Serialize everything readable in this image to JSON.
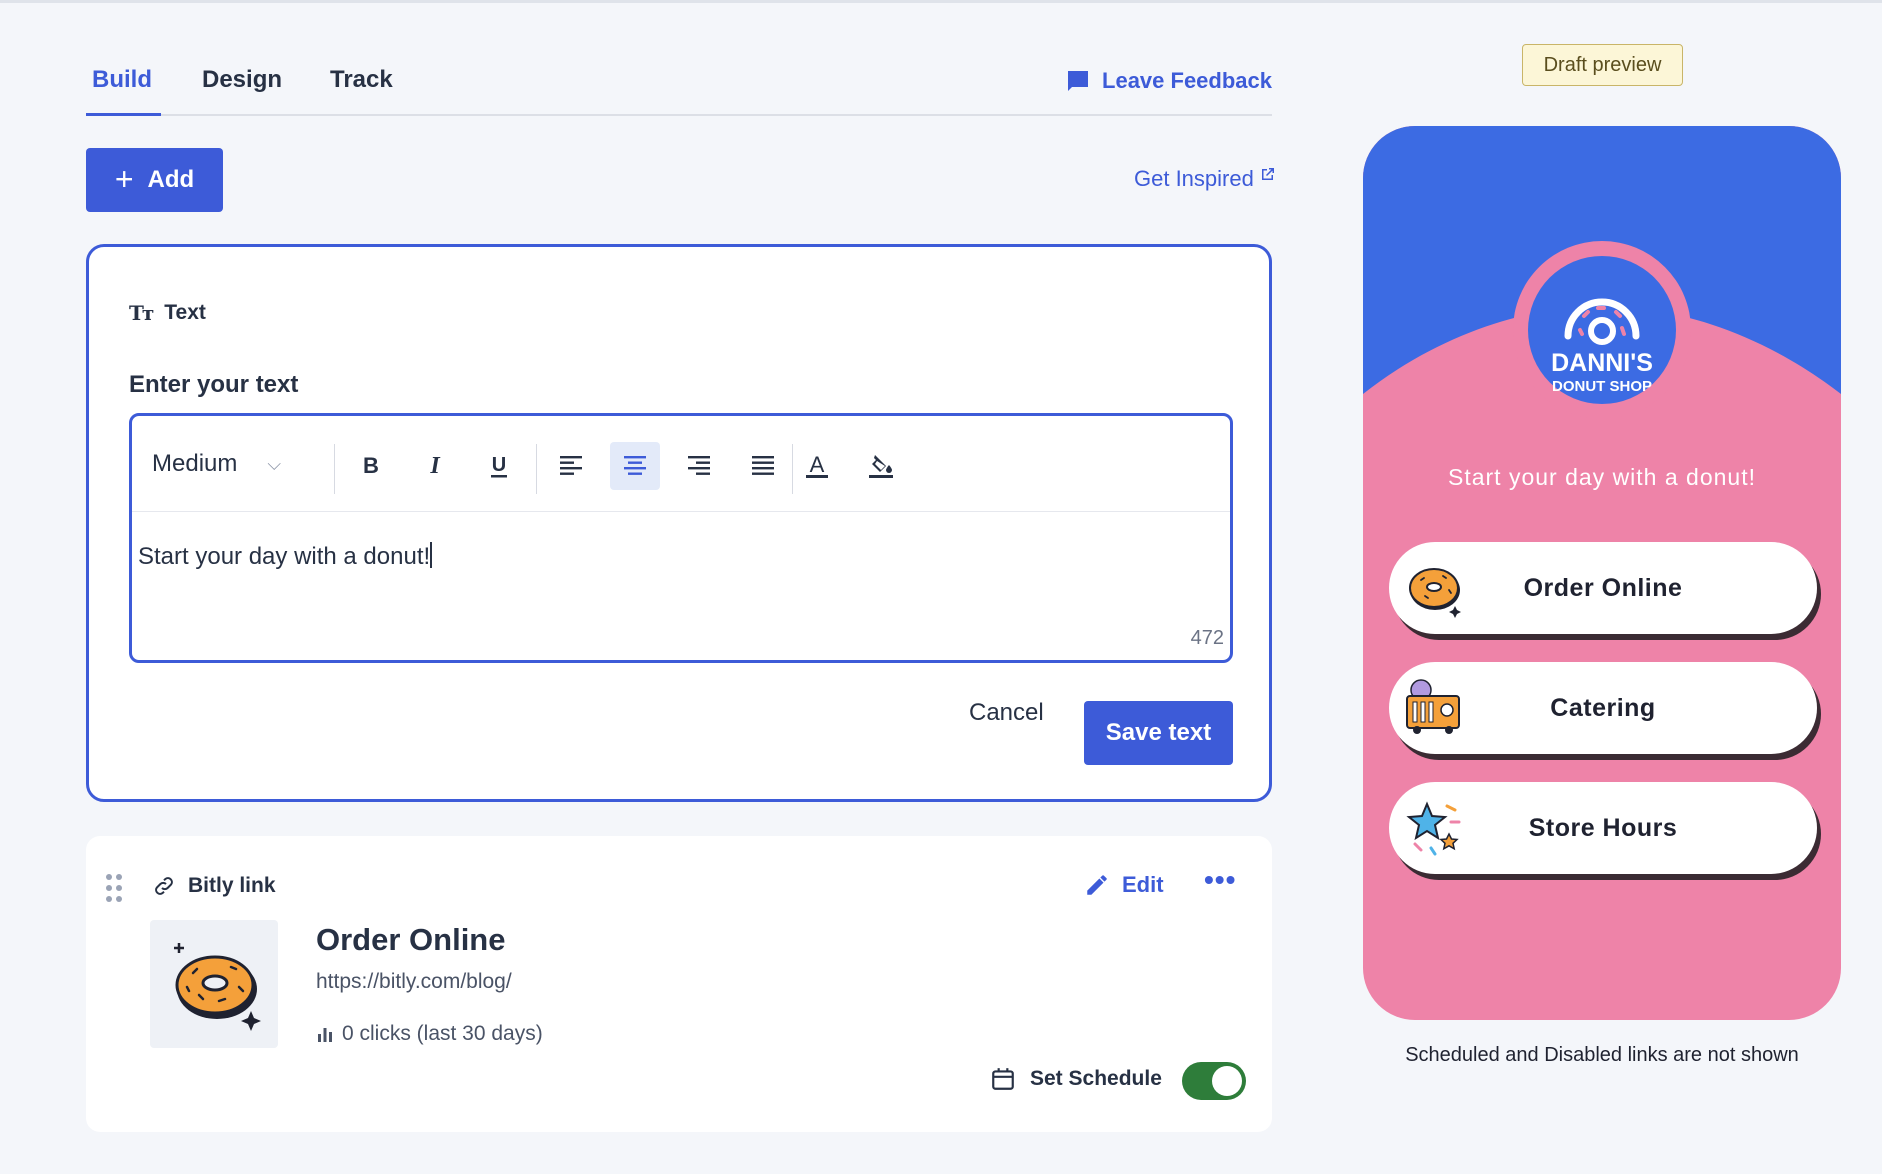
{
  "tabs": [
    {
      "label": "Build",
      "active": true
    },
    {
      "label": "Design",
      "active": false
    },
    {
      "label": "Track",
      "active": false
    }
  ],
  "feedback_label": "Leave Feedback",
  "add_label": "Add",
  "inspired_label": "Get Inspired",
  "editor": {
    "type_label": "Text",
    "field_label": "Enter your text",
    "size_value": "Medium",
    "text_value": "Start your day with a donut!",
    "char_count": "472",
    "cancel_label": "Cancel",
    "save_label": "Save text",
    "active_alignment": "center"
  },
  "link_card": {
    "type_label": "Bitly link",
    "edit_label": "Edit",
    "title": "Order Online",
    "url": "https://bitly.com/blog/",
    "clicks": "0 clicks (last 30 days)",
    "schedule_label": "Set Schedule",
    "enabled": true
  },
  "preview": {
    "badge": "Draft preview",
    "logo_name": "DANNI'S",
    "logo_sub": "DONUT SHOP",
    "tagline": "Start your day with a donut!",
    "buttons": [
      {
        "label": "Order Online",
        "icon": "donut-icon"
      },
      {
        "label": "Catering",
        "icon": "food-truck-icon"
      },
      {
        "label": "Store Hours",
        "icon": "stars-icon"
      }
    ],
    "footnote": "Scheduled and Disabled links are not shown"
  },
  "colors": {
    "accent": "#3d5bd8",
    "preview_blue": "#3c6be3",
    "preview_pink": "#ee83a8",
    "toggle_on": "#2e7d3a",
    "background": "#f4f6fa"
  }
}
